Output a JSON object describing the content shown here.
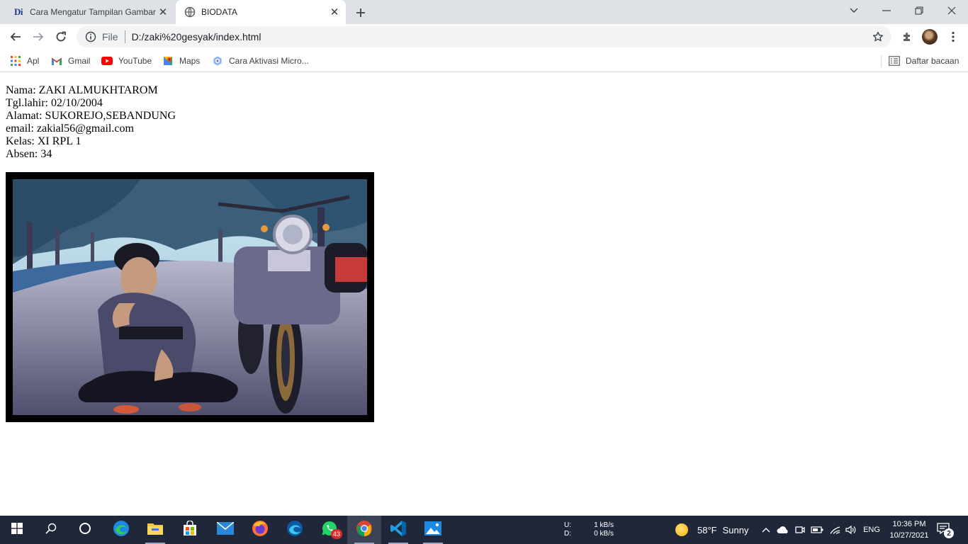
{
  "browser": {
    "tabs": [
      {
        "title": "Cara Mengatur Tampilan Gambar",
        "favicon": "di-logo",
        "active": false
      },
      {
        "title": "BIODATA",
        "favicon": "globe-icon",
        "active": true
      }
    ],
    "address": {
      "scheme_label": "File",
      "url": "D:/zaki%20gesyak/index.html"
    },
    "bookmarks": [
      {
        "label": "Apl",
        "icon": "apps-grid-icon"
      },
      {
        "label": "Gmail",
        "icon": "gmail-icon"
      },
      {
        "label": "YouTube",
        "icon": "youtube-icon"
      },
      {
        "label": "Maps",
        "icon": "maps-icon"
      },
      {
        "label": "Cara Aktivasi Micro...",
        "icon": "site-icon"
      }
    ],
    "reading_list_label": "Daftar bacaan"
  },
  "biodata": {
    "nama": "Nama: ZAKI ALMUKHTAROM",
    "tgl_lahir": "Tgl.lahir: 02/10/2004",
    "alamat": "Alamat: SUKOREJO,SEBANDUNG",
    "email": "email: zakial56@gmail.com",
    "kelas": "Kelas: XI RPL 1",
    "absen": "Absen: 34"
  },
  "taskbar": {
    "apps": [
      "start-icon",
      "search-icon",
      "cortana-icon",
      "edge-icon",
      "file-explorer-icon",
      "store-icon",
      "mail-icon",
      "firefox-icon",
      "edge-dev-icon",
      "whatsapp-icon",
      "chrome-icon",
      "vscode-icon",
      "photos-icon"
    ],
    "whatsapp_badge": "43",
    "network": {
      "up_label": "U:",
      "up_value": "1 kB/s",
      "down_label": "D:",
      "down_value": "0 kB/s"
    },
    "weather": {
      "temp": "58°F",
      "desc": "Sunny"
    },
    "language": "ENG",
    "time": "10:36 PM",
    "date": "10/27/2021",
    "notification_count": "2"
  }
}
